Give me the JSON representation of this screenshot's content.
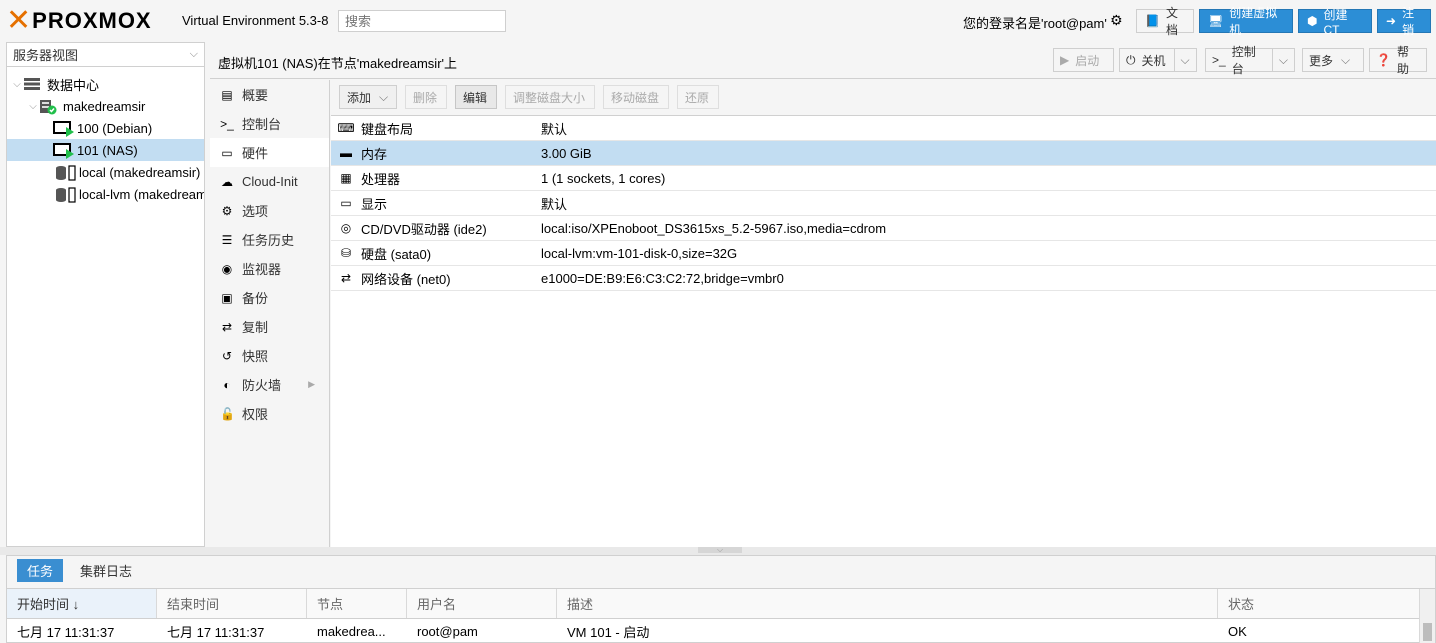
{
  "brand": {
    "name": "PROXMOX",
    "product": "Virtual Environment 5.3-8",
    "accent": "#e57000"
  },
  "search": {
    "placeholder": "搜索"
  },
  "topbar": {
    "login_text": "您的登录名是'root@pam'",
    "docs_label": "文档",
    "create_vm_label": "创建虚拟机",
    "create_ct_label": "创建CT",
    "logout_label": "注销"
  },
  "sidebar": {
    "view_label": "服务器视图",
    "tree": [
      {
        "label": "数据中心",
        "icon": "datacenter-icon"
      },
      {
        "label": "makedreamsir",
        "icon": "node-icon"
      },
      {
        "label": "100 (Debian)",
        "icon": "vm-running-icon"
      },
      {
        "label": "101 (NAS)",
        "icon": "vm-running-icon",
        "selected": true
      },
      {
        "label": "local (makedreamsir)",
        "icon": "storage-icon"
      },
      {
        "label": "local-lvm (makedreamsir)",
        "icon": "storage-icon"
      }
    ]
  },
  "header": {
    "title": "虚拟机101 (NAS)在节点'makedreamsir'上",
    "start_label": "启动",
    "shutdown_label": "关机",
    "console_label": "控制台",
    "more_label": "更多",
    "help_label": "帮助"
  },
  "subnav": {
    "items": [
      {
        "label": "概要",
        "icon": "book-icon"
      },
      {
        "label": "控制台",
        "icon": "terminal-icon"
      },
      {
        "label": "硬件",
        "icon": "monitor-icon",
        "active": true
      },
      {
        "label": "Cloud-Init",
        "icon": "cloud-icon"
      },
      {
        "label": "选项",
        "icon": "gear-icon"
      },
      {
        "label": "任务历史",
        "icon": "list-icon"
      },
      {
        "label": "监视器",
        "icon": "eye-icon"
      },
      {
        "label": "备份",
        "icon": "floppy-icon"
      },
      {
        "label": "复制",
        "icon": "retweet-icon"
      },
      {
        "label": "快照",
        "icon": "history-icon"
      },
      {
        "label": "防火墙",
        "icon": "shield-icon"
      },
      {
        "label": "权限",
        "icon": "unlock-icon"
      }
    ]
  },
  "hardware": {
    "toolbar": {
      "add_label": "添加",
      "remove_label": "删除",
      "edit_label": "编辑",
      "resize_label": "调整磁盘大小",
      "move_label": "移动磁盘",
      "revert_label": "还原"
    },
    "rows": [
      {
        "key": "键盘布局",
        "value": "默认",
        "icon": "keyboard-icon"
      },
      {
        "key": "内存",
        "value": "3.00 GiB",
        "icon": "memory-icon",
        "selected": true
      },
      {
        "key": "处理器",
        "value": "1 (1 sockets, 1 cores)",
        "icon": "cpu-icon"
      },
      {
        "key": "显示",
        "value": "默认",
        "icon": "display-icon"
      },
      {
        "key": "CD/DVD驱动器 (ide2)",
        "value": "local:iso/XPEnoboot_DS3615xs_5.2-5967.iso,media=cdrom",
        "icon": "cdrom-icon"
      },
      {
        "key": "硬盘 (sata0)",
        "value": "local-lvm:vm-101-disk-0,size=32G",
        "icon": "hdd-icon"
      },
      {
        "key": "网络设备 (net0)",
        "value": "e1000=DE:B9:E6:C3:C2:72,bridge=vmbr0",
        "icon": "network-icon"
      }
    ]
  },
  "bottom": {
    "tabs": [
      {
        "label": "任务",
        "active": true
      },
      {
        "label": "集群日志"
      }
    ],
    "columns": [
      "开始时间 ↓",
      "结束时间",
      "节点",
      "用户名",
      "描述",
      "状态"
    ],
    "rows": [
      [
        "七月 17 11:31:37",
        "七月 17 11:31:37",
        "makedrea...",
        "root@pam",
        "VM 101 - 启动",
        "OK"
      ]
    ]
  }
}
